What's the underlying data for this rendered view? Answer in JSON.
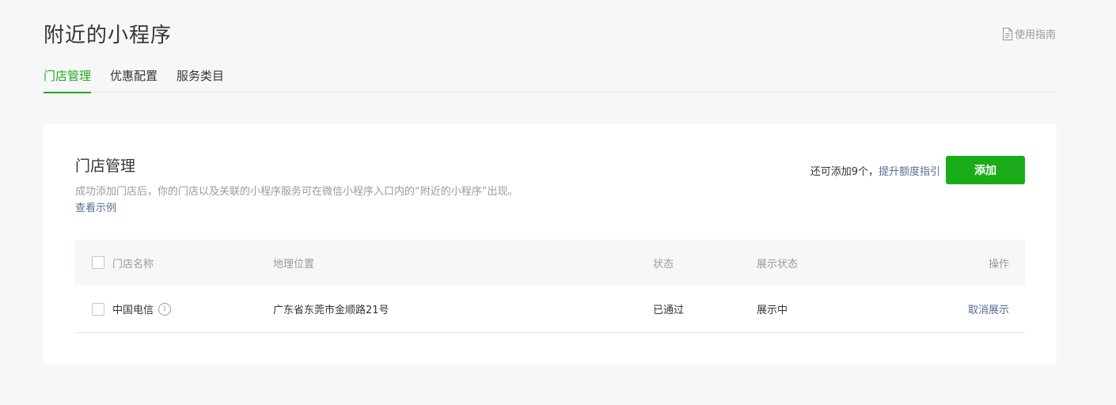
{
  "header": {
    "title": "附近的小程序",
    "guide_label": "使用指南",
    "guide_icon": "document-icon"
  },
  "tabs": [
    {
      "label": "门店管理",
      "active": true
    },
    {
      "label": "优惠配置",
      "active": false
    },
    {
      "label": "服务类目",
      "active": false
    }
  ],
  "card": {
    "title": "门店管理",
    "description": "成功添加门店后，你的门店以及关联的小程序服务可在微信小程序入口内的“附近的小程序”出现。",
    "example_link": "查看示例",
    "quota_text": "还可添加9个，",
    "quota_link": "提升额度指引",
    "add_button": "添加"
  },
  "table": {
    "columns": [
      "门店名称",
      "地理位置",
      "状态",
      "展示状态",
      "操作"
    ],
    "rows": [
      {
        "name": "中国电信",
        "location": "广东省东莞市金顺路21号",
        "status": "已通过",
        "display_status": "展示中",
        "action": "取消展示"
      }
    ]
  },
  "colors": {
    "accent": "#1aad19",
    "link": "#576b95",
    "muted": "#9a9a9a",
    "background": "#f6f7f9"
  }
}
